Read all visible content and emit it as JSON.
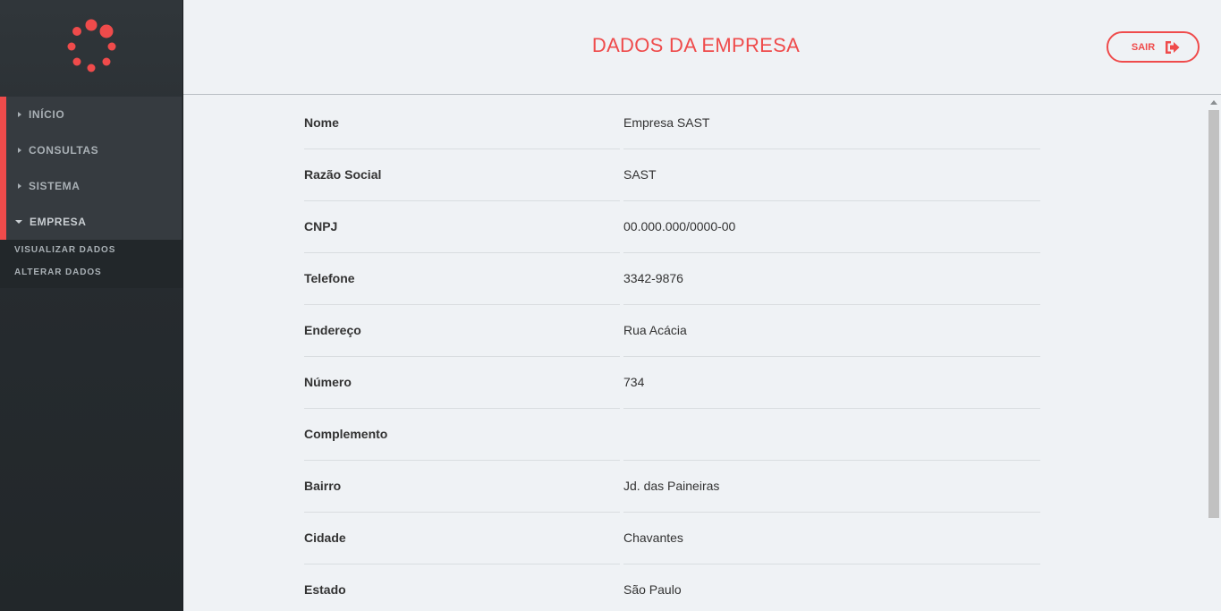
{
  "sidebar": {
    "items": [
      {
        "label": "INÍCIO"
      },
      {
        "label": "CONSULTAS"
      },
      {
        "label": "SISTEMA"
      },
      {
        "label": "EMPRESA"
      }
    ],
    "submenu": [
      {
        "label": "VISUALIZAR DADOS"
      },
      {
        "label": "ALTERAR DADOS"
      }
    ]
  },
  "header": {
    "title": "DADOS DA EMPRESA",
    "logout_label": "SAIR"
  },
  "company": {
    "fields": [
      {
        "label": "Nome",
        "value": "Empresa SAST"
      },
      {
        "label": "Razão Social",
        "value": "SAST"
      },
      {
        "label": "CNPJ",
        "value": "00.000.000/0000-00"
      },
      {
        "label": "Telefone",
        "value": "3342-9876"
      },
      {
        "label": "Endereço",
        "value": "Rua Acácia"
      },
      {
        "label": "Número",
        "value": "734"
      },
      {
        "label": "Complemento",
        "value": ""
      },
      {
        "label": "Bairro",
        "value": "Jd. das Paineiras"
      },
      {
        "label": "Cidade",
        "value": "Chavantes"
      },
      {
        "label": "Estado",
        "value": "São Paulo"
      }
    ]
  },
  "colors": {
    "accent": "#ef4b4b",
    "sidebar_bg": "#2b3034",
    "content_bg": "#eff2f5"
  }
}
